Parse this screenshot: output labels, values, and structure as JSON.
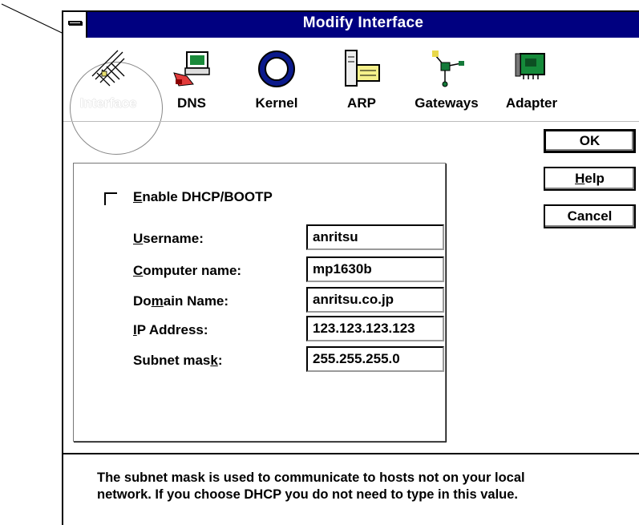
{
  "window": {
    "title": "Modify Interface"
  },
  "toolbar": {
    "items": [
      {
        "label": "Interface",
        "icon": "interface-icon",
        "selected": true
      },
      {
        "label": "DNS",
        "icon": "dns-icon"
      },
      {
        "label": "Kernel",
        "icon": "kernel-icon"
      },
      {
        "label": "ARP",
        "icon": "arp-icon"
      },
      {
        "label": "Gateways",
        "icon": "gateways-icon"
      },
      {
        "label": "Adapter",
        "icon": "adapter-icon"
      }
    ]
  },
  "buttons": {
    "ok": "OK",
    "help_pre": "",
    "help_u": "H",
    "help_post": "elp",
    "cancel": "Cancel"
  },
  "form": {
    "dhcp": {
      "u": "E",
      "rest": "nable DHCP/BOOTP",
      "checked": false
    },
    "fields": [
      {
        "pre": "",
        "u": "U",
        "post": "sername:",
        "value": "anritsu"
      },
      {
        "pre": "",
        "u": "C",
        "post": "omputer name:",
        "value": "mp1630b"
      },
      {
        "pre": "Do",
        "u": "m",
        "post": "ain Name:",
        "value": "anritsu.co.jp"
      },
      {
        "pre": "",
        "u": "I",
        "post": "P Address:",
        "value": "123.123.123.123"
      },
      {
        "pre": "Subnet mas",
        "u": "k",
        "post": ":",
        "value": "255.255.255.0"
      }
    ]
  },
  "help_text": {
    "line1": "The subnet mask is used to communicate to hosts not on your local",
    "line2": "network.  If you choose DHCP you do not need to type in this value."
  },
  "colors": {
    "titlebar": "#000080",
    "title_text": "#ffffff"
  }
}
